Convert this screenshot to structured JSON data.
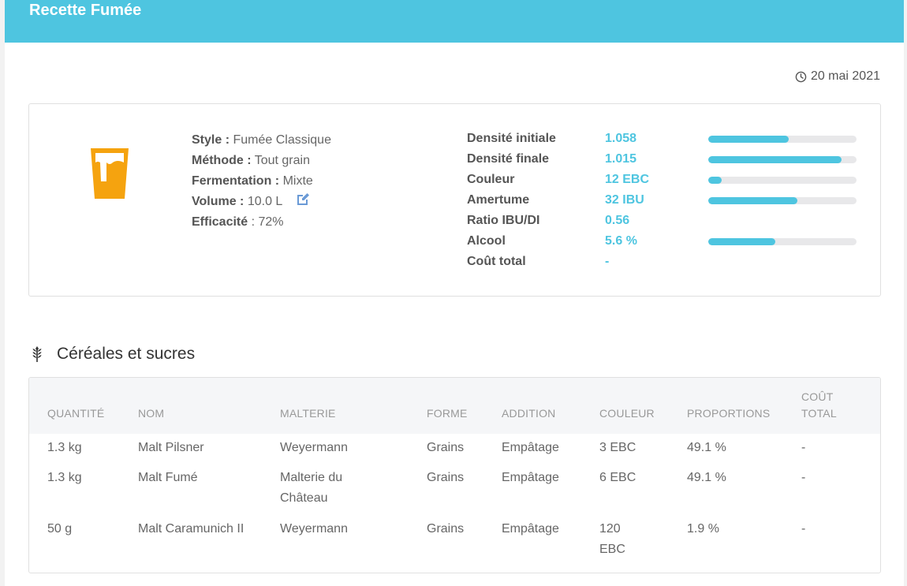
{
  "header": {
    "title": "Recette Fumée"
  },
  "date": "20 mai 2021",
  "recipe": {
    "style_label": "Style :",
    "style_value": "Fumée Classique",
    "method_label": "Méthode :",
    "method_value": "Tout grain",
    "fermentation_label": "Fermentation :",
    "fermentation_value": "Mixte",
    "volume_label": "Volume :",
    "volume_value": "10.0 L",
    "efficiency_label": "Efficacité",
    "efficiency_value": ": 72%"
  },
  "stats": [
    {
      "label": "Densité initiale",
      "value": "1.058",
      "bar": 0.54
    },
    {
      "label": "Densité finale",
      "value": "1.015",
      "bar": 0.9
    },
    {
      "label": "Couleur",
      "value": "12 EBC",
      "bar": 0.09
    },
    {
      "label": "Amertume",
      "value": "32 IBU",
      "bar": 0.6
    },
    {
      "label": "Ratio IBU/DI",
      "value": "0.56",
      "bar": null
    },
    {
      "label": "Alcool",
      "value": "5.6 %",
      "bar": 0.45
    },
    {
      "label": "Coût total",
      "value": "-",
      "bar": null
    }
  ],
  "section": {
    "title": "Céréales et sucres"
  },
  "table": {
    "headers": [
      "QUANTITÉ",
      "NOM",
      "MALTERIE",
      "FORME",
      "ADDITION",
      "COULEUR",
      "PROPORTIONS",
      "COÛT\nTOTAL"
    ],
    "rows": [
      [
        "1.3 kg",
        "Malt Pilsner",
        "Weyermann",
        "Grains",
        "Empâtage",
        "3 EBC",
        "49.1 %",
        "-"
      ],
      [
        "1.3 kg",
        "Malt Fumé",
        "Malterie du Château",
        "Grains",
        "Empâtage",
        "6 EBC",
        "49.1 %",
        "-"
      ],
      [
        "50 g",
        "Malt Caramunich II",
        "Weyermann",
        "Grains",
        "Empâtage",
        "120 EBC",
        "1.9 %",
        "-"
      ]
    ]
  },
  "colors": {
    "accent": "#4ec5e0",
    "glass": "#f5a30f",
    "edit": "#6a9ad6"
  }
}
